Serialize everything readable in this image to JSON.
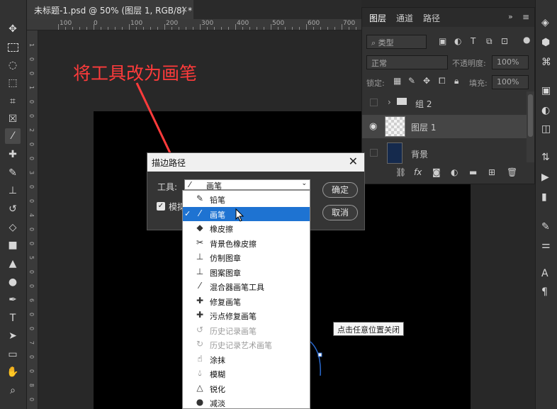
{
  "document_tab": {
    "title": "未标题-1.psd @ 50% (图层 1, RGB/8) *",
    "close": "×"
  },
  "ruler": {
    "labels": [
      "100",
      "0",
      "100",
      "200",
      "300",
      "400",
      "500",
      "600",
      "700"
    ]
  },
  "vruler": {
    "labels": [
      "1",
      "0",
      "0",
      "1",
      "0",
      "0",
      "2",
      "0",
      "0",
      "3",
      "0",
      "0",
      "4",
      "0",
      "0",
      "5",
      "0",
      "0",
      "6",
      "0",
      "0",
      "7",
      "0",
      "0",
      "8",
      "0"
    ]
  },
  "annotation": "将工具改为画笔",
  "toolbar": {
    "tools": [
      "move-tool",
      "marquee-tool",
      "lasso-tool",
      "object-select-tool",
      "crop-tool",
      "frame-tool",
      "eyedropper-tool",
      "healing-tool",
      "brush-tool",
      "stamp-tool",
      "history-brush-tool",
      "eraser-tool",
      "gradient-tool",
      "sharpen-tool",
      "dodge-tool",
      "pen-tool",
      "type-tool",
      "path-select-tool",
      "rectangle-tool",
      "hand-tool",
      "zoom-tool"
    ]
  },
  "layers_panel": {
    "tabs": [
      "图层",
      "通道",
      "路径"
    ],
    "kind_filter": "类型",
    "blend_mode": "正常",
    "opacity_label": "不透明度:",
    "opacity_value": "100%",
    "lock_label": "锁定:",
    "fill_label": "填充:",
    "fill_value": "100%",
    "layers": [
      {
        "name": "组 2",
        "type": "group",
        "visible": false
      },
      {
        "name": "图层 1",
        "type": "layer",
        "visible": true,
        "selected": true
      },
      {
        "name": "背景",
        "type": "background",
        "visible": false
      }
    ],
    "footer_icons": [
      "link-icon",
      "fx-icon",
      "mask-icon",
      "adjustment-icon",
      "folder-icon",
      "new-layer-icon",
      "trash-icon"
    ]
  },
  "dialog": {
    "title": "描边路径",
    "tool_label": "工具:",
    "tool_value": "画笔",
    "simulate_label": "模拟压力",
    "ok": "确定",
    "cancel": "取消"
  },
  "dropdown": {
    "items": [
      {
        "label": "铅笔",
        "icon": "pencil-icon",
        "selected": false,
        "disabled": false
      },
      {
        "label": "画笔",
        "icon": "brush-icon",
        "selected": true,
        "disabled": false
      },
      {
        "label": "橡皮擦",
        "icon": "eraser-icon",
        "selected": false,
        "disabled": false
      },
      {
        "label": "背景色橡皮擦",
        "icon": "bg-eraser-icon",
        "selected": false,
        "disabled": false
      },
      {
        "label": "仿制图章",
        "icon": "clone-stamp-icon",
        "selected": false,
        "disabled": false
      },
      {
        "label": "图案图章",
        "icon": "pattern-stamp-icon",
        "selected": false,
        "disabled": false
      },
      {
        "label": "混合器画笔工具",
        "icon": "mixer-brush-icon",
        "selected": false,
        "disabled": false
      },
      {
        "label": "修复画笔",
        "icon": "healing-brush-icon",
        "selected": false,
        "disabled": false
      },
      {
        "label": "污点修复画笔",
        "icon": "spot-healing-icon",
        "selected": false,
        "disabled": false
      },
      {
        "label": "历史记录画笔",
        "icon": "history-brush-icon",
        "selected": false,
        "disabled": true
      },
      {
        "label": "历史记录艺术画笔",
        "icon": "art-history-brush-icon",
        "selected": false,
        "disabled": true
      },
      {
        "label": "涂抹",
        "icon": "smudge-icon",
        "selected": false,
        "disabled": false
      },
      {
        "label": "模糊",
        "icon": "blur-icon",
        "selected": false,
        "disabled": false
      },
      {
        "label": "锐化",
        "icon": "sharpen-icon",
        "selected": false,
        "disabled": false
      },
      {
        "label": "减淡",
        "icon": "dodge-icon",
        "selected": false,
        "disabled": false
      }
    ]
  },
  "tooltip": "点击任意位置关闭",
  "colors": {
    "accent": "#1e73d2",
    "annotation": "#ff3b3b",
    "panel": "#323232",
    "canvas": "#000000"
  }
}
